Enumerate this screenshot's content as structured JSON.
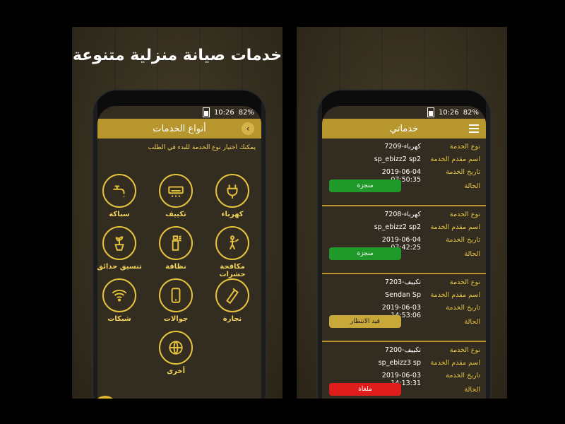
{
  "statusbar": {
    "signal": "82%",
    "time": "10:26"
  },
  "left": {
    "promo_title": "خدمات صيانة منزلية متنوعة",
    "appbar_title": "أنواع الخدمات",
    "hint": "يمكنك اختيار نوع الخدمة للبدء في الطلب",
    "services": [
      {
        "label": "كهرباء",
        "icon": "electric-plug-icon"
      },
      {
        "label": "تكييف",
        "icon": "air-conditioner-icon"
      },
      {
        "label": "سباكة",
        "icon": "faucet-icon"
      },
      {
        "label": "مكافحة حشرات",
        "icon": "pest-control-icon"
      },
      {
        "label": "نظافة",
        "icon": "cleaning-spray-icon"
      },
      {
        "label": "تنسيق حدائق",
        "icon": "plant-pot-icon"
      },
      {
        "label": "نجارة",
        "icon": "saw-icon"
      },
      {
        "label": "جوالات",
        "icon": "mobile-phone-icon"
      },
      {
        "label": "شبكات",
        "icon": "wifi-icon"
      },
      {
        "label": "أخرى",
        "icon": "globe-icon"
      }
    ],
    "fab_label": "$"
  },
  "right": {
    "appbar_title": "خدماتي",
    "labels": {
      "type": "نوع الخدمة",
      "provider": "اسم مقدم الخدمة",
      "date": "تاريخ الخدمة",
      "status": "الحالة"
    },
    "orders": [
      {
        "type": "7209-كهرباء",
        "provider": "sp_ebizz2 sp2",
        "date": "2019-06-04 07:50:35",
        "status": "منجزة",
        "status_kind": "done"
      },
      {
        "type": "7208-كهرباء",
        "provider": "sp_ebizz2 sp2",
        "date": "2019-06-04 07:42:25",
        "status": "منجزة",
        "status_kind": "done"
      },
      {
        "type": "7203-تكييف",
        "provider": "Sendan Sp",
        "date": "2019-06-03 14:53:06",
        "status": "قيد الانتظار",
        "status_kind": "wait"
      },
      {
        "type": "7200-تكييف",
        "provider": "sp_ebizz3 sp",
        "date": "2019-06-03 14:13:31",
        "status": "ملغاة",
        "status_kind": "cancel"
      }
    ]
  },
  "colors": {
    "accent": "#b7962e",
    "gold_text": "#e6c33e",
    "done": "#1f9a2a",
    "cancel": "#e01d1d"
  }
}
